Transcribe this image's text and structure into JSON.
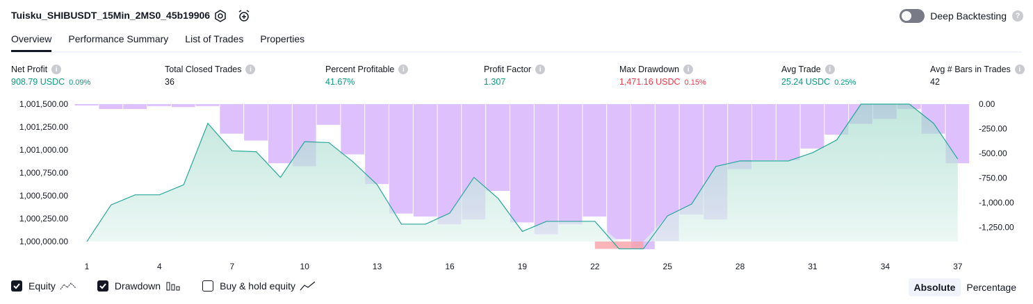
{
  "header": {
    "title": "Tuisku_SHIBUSDT_15Min_2MS0_45b19906",
    "deep_backtesting_label": "Deep Backtesting"
  },
  "tabs": [
    "Overview",
    "Performance Summary",
    "List of Trades",
    "Properties"
  ],
  "metrics": [
    {
      "label": "Net Profit",
      "value": "908.79 USDC",
      "pct": "0.09%",
      "color": "#089981"
    },
    {
      "label": "Total Closed Trades",
      "value": "36",
      "pct": "",
      "color": "#131722"
    },
    {
      "label": "Percent Profitable",
      "value": "41.67%",
      "pct": "",
      "color": "#089981"
    },
    {
      "label": "Profit Factor",
      "value": "1.307",
      "pct": "",
      "color": "#089981"
    },
    {
      "label": "Max Drawdown",
      "value": "1,471.16 USDC",
      "pct": "0.15%",
      "color": "#f23645"
    },
    {
      "label": "Avg Trade",
      "value": "25.24 USDC",
      "pct": "0.25%",
      "color": "#089981"
    },
    {
      "label": "Avg # Bars in Trades",
      "value": "42",
      "pct": "",
      "color": "#131722"
    }
  ],
  "chart_data": {
    "type": "area",
    "x_ticks": [
      "1",
      "4",
      "7",
      "10",
      "13",
      "16",
      "19",
      "22",
      "25",
      "28",
      "31",
      "34",
      "37"
    ],
    "left_axis": {
      "ticks": [
        "1,001,500.00",
        "1,001,250.00",
        "1,001,000.00",
        "1,000,750.00",
        "1,000,500.00",
        "1,000,250.00",
        "1,000,000.00"
      ],
      "ylim": [
        1000000,
        1001500
      ]
    },
    "right_axis": {
      "ticks": [
        "0.00",
        "-250.00",
        "-500.00",
        "-750.00",
        "-1,000.00",
        "-1,250.00"
      ],
      "ylim": [
        -1400,
        0
      ]
    },
    "series": [
      {
        "name": "Equity",
        "color": "#26a69a",
        "x": [
          1,
          2,
          3,
          4,
          5,
          6,
          7,
          8,
          9,
          10,
          11,
          12,
          13,
          14,
          15,
          16,
          17,
          18,
          19,
          20,
          21,
          22,
          23,
          24,
          25,
          26,
          27,
          28,
          29,
          30,
          31,
          32,
          33,
          34,
          35,
          36,
          37
        ],
        "values": [
          1000000,
          1000400,
          1000510,
          1000510,
          1000620,
          1001290,
          1000990,
          1000980,
          1000700,
          1001090,
          1001080,
          1000870,
          1000620,
          1000190,
          1000190,
          1000310,
          1000700,
          1000470,
          1000110,
          1000220,
          1000220,
          1000220,
          999920,
          999920,
          1000280,
          1000410,
          1000820,
          1000880,
          1000880,
          1000880,
          1000970,
          1001110,
          1001500,
          1001500,
          1001500,
          1001290,
          1000900
        ]
      },
      {
        "name": "Drawdown",
        "color": "#d1a9ff",
        "x": [
          1,
          2,
          3,
          4,
          5,
          6,
          7,
          8,
          9,
          10,
          11,
          12,
          13,
          14,
          15,
          16,
          17,
          18,
          19,
          20,
          21,
          22,
          23,
          24,
          25,
          26,
          27,
          28,
          29,
          30,
          31,
          32,
          33,
          34,
          35,
          36,
          37
        ],
        "values": [
          -10,
          -50,
          -50,
          -20,
          -30,
          -20,
          -300,
          -370,
          -600,
          -630,
          -210,
          -510,
          -810,
          -1110,
          -1140,
          -1220,
          -1170,
          -880,
          -1200,
          -1320,
          -1220,
          -1140,
          -1370,
          -1471,
          -1390,
          -1120,
          -1170,
          -660,
          -570,
          -570,
          -450,
          -310,
          -200,
          -150,
          -50,
          -300,
          -600
        ]
      }
    ],
    "legend": [
      {
        "label": "Equity",
        "checked": true
      },
      {
        "label": "Drawdown",
        "checked": true
      },
      {
        "label": "Buy & hold equity",
        "checked": false
      }
    ],
    "modes": [
      "Absolute",
      "Percentage"
    ],
    "active_mode": "Absolute"
  }
}
